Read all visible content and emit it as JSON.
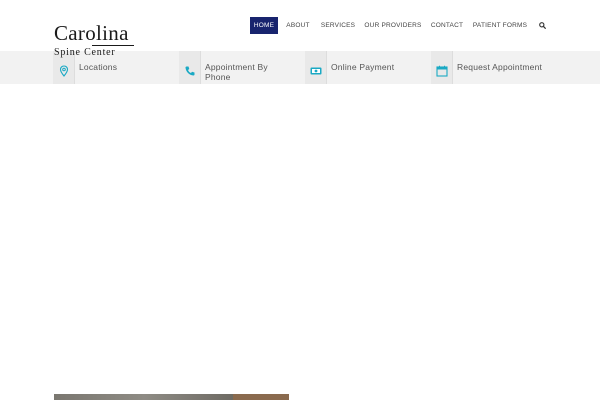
{
  "logo": {
    "line1": "Carolina",
    "line2": "Spine Center"
  },
  "nav": {
    "items": [
      {
        "label": "Home",
        "active": true
      },
      {
        "label": "About",
        "active": false
      },
      {
        "label": "Services",
        "active": false
      },
      {
        "label": "Our Providers",
        "active": false
      },
      {
        "label": "Contact",
        "active": false
      },
      {
        "label": "Patient Forms",
        "active": false
      }
    ],
    "search_icon": "search-icon"
  },
  "infobar": {
    "items": [
      {
        "label": "Locations",
        "icon": "map-pin-icon"
      },
      {
        "label": "Appointment By Phone",
        "icon": "phone-icon"
      },
      {
        "label": "Online Payment",
        "icon": "money-icon"
      },
      {
        "label": "Request Appointment",
        "icon": "calendar-icon"
      }
    ]
  },
  "colors": {
    "nav_active": "#18246e",
    "accent": "#1aa9c4",
    "infobar_bg": "#f2f2f2"
  }
}
